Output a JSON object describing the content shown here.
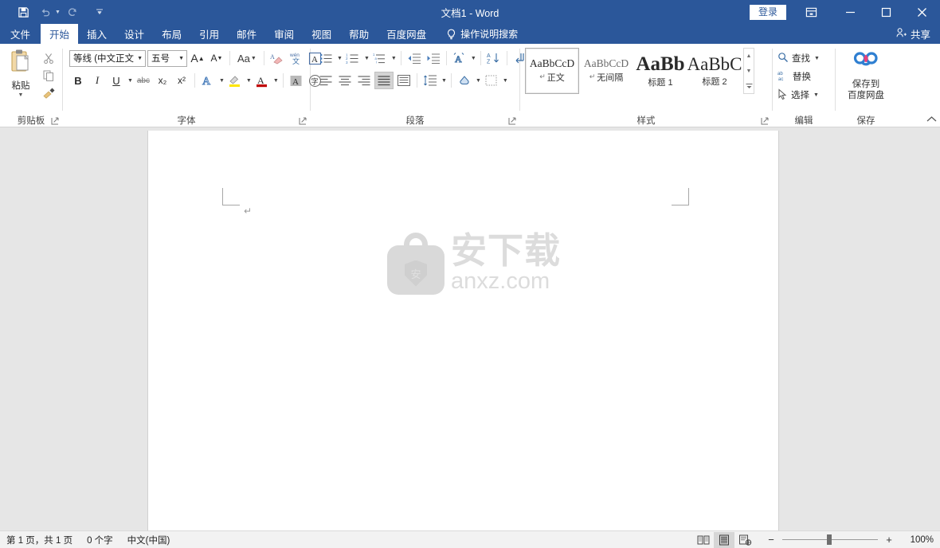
{
  "titlebar": {
    "document_title": "文档1  -  Word",
    "quick_access": [
      {
        "name": "save",
        "icon": "save-icon"
      },
      {
        "name": "undo",
        "icon": "undo-icon"
      },
      {
        "name": "redo",
        "icon": "redo-icon"
      },
      {
        "name": "customize",
        "icon": "chevron-down-icon"
      }
    ],
    "signin_label": "登录",
    "ribbon_display_options": "ribbon-display-options-icon",
    "minimize": "minimize-icon",
    "maximize": "maximize-icon",
    "close": "close-icon",
    "accent_color": "#2b579a"
  },
  "tabs": [
    {
      "label": "文件",
      "active": false
    },
    {
      "label": "开始",
      "active": true
    },
    {
      "label": "插入",
      "active": false
    },
    {
      "label": "设计",
      "active": false
    },
    {
      "label": "布局",
      "active": false
    },
    {
      "label": "引用",
      "active": false
    },
    {
      "label": "邮件",
      "active": false
    },
    {
      "label": "审阅",
      "active": false
    },
    {
      "label": "视图",
      "active": false
    },
    {
      "label": "帮助",
      "active": false
    },
    {
      "label": "百度网盘",
      "active": false
    }
  ],
  "tellme": {
    "label": "操作说明搜索"
  },
  "share": {
    "label": "共享"
  },
  "ribbon": {
    "clipboard": {
      "group_label": "剪贴板",
      "paste_label": "粘贴",
      "cut": "cut-icon",
      "copy": "copy-icon",
      "format_painter": "format-painter-icon"
    },
    "font": {
      "group_label": "字体",
      "font_name": "等线 (中文正文",
      "font_size": "五号",
      "grow_font": "A",
      "shrink_font": "A",
      "change_case": "Aa",
      "clear_formatting": "clear-formatting-icon",
      "phonetic_top": "wén",
      "phonetic_bottom": "文",
      "char_border": "A",
      "bold": "B",
      "italic": "I",
      "underline": "U",
      "strikethrough": "abc",
      "subscript": "x₂",
      "superscript": "x²",
      "text_effects": "A",
      "highlight": "highlight-icon",
      "font_color": "A",
      "char_shading": "A",
      "enclose_char": "字"
    },
    "paragraph": {
      "group_label": "段落",
      "bullets": "bullets-icon",
      "numbering": "numbering-icon",
      "multilevel": "multilevel-list-icon",
      "decrease_indent": "decrease-indent-icon",
      "increase_indent": "increase-indent-icon",
      "asian_layout": "asian-layout-icon",
      "sort": "sort-icon",
      "show_marks": "show-formatting-marks-icon",
      "align_left": "align-left-icon",
      "align_center": "align-center-icon",
      "align_right": "align-right-icon",
      "justify": "justify-icon",
      "distribute": "distribute-icon",
      "line_spacing": "line-spacing-icon",
      "shading": "shading-icon",
      "borders": "borders-icon"
    },
    "styles": {
      "group_label": "样式",
      "items": [
        {
          "preview": "AaBbCcD",
          "name": "正文",
          "selected": true,
          "pilcrow": true,
          "size": "normal"
        },
        {
          "preview": "AaBbCcD",
          "name": "无间隔",
          "selected": false,
          "pilcrow": true,
          "size": "normal"
        },
        {
          "preview": "AaBb",
          "name": "标题 1",
          "selected": false,
          "pilcrow": false,
          "size": "big"
        },
        {
          "preview": "AaBbC",
          "name": "标题 2",
          "selected": false,
          "pilcrow": false,
          "size": "big2"
        }
      ],
      "scroll_up": "▲",
      "scroll_down": "▼",
      "more": "▼"
    },
    "editing": {
      "group_label": "编辑",
      "find_label": "查找",
      "replace_label": "替换",
      "select_label": "选择"
    },
    "baidu": {
      "group_label": "保存",
      "button_line1": "保存到",
      "button_line2": "百度网盘",
      "icon": "baidu-netdisk-icon"
    },
    "collapse_ribbon": "collapse-ribbon-icon"
  },
  "document": {
    "paragraph_mark": "↵",
    "watermark": {
      "cn_text": "安下载",
      "en_text": "anxz.com",
      "shield_char": "安"
    }
  },
  "statusbar": {
    "page_info": "第 1 页，共 1 页",
    "word_count": "0 个字",
    "language": "中文(中国)",
    "views": [
      {
        "name": "read-mode",
        "icon": "read-mode-icon",
        "active": false
      },
      {
        "name": "print-layout",
        "icon": "print-layout-icon",
        "active": true
      },
      {
        "name": "web-layout",
        "icon": "web-layout-icon",
        "active": false
      }
    ],
    "zoom_out": "−",
    "zoom_in": "+",
    "zoom_level": "100%"
  }
}
